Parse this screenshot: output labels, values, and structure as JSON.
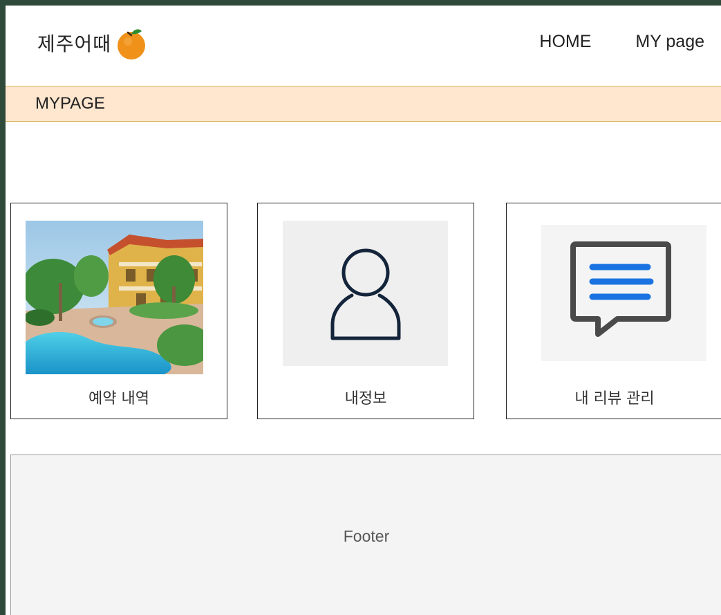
{
  "brand": {
    "name": "제주어때",
    "logo_icon": "orange-icon",
    "accent": "#f0921a"
  },
  "nav": {
    "home_label": "HOME",
    "mypage_label": "MY page"
  },
  "subbar": {
    "title": "MYPAGE",
    "background": "#ffe6cf"
  },
  "cards": [
    {
      "label": "예약 내역",
      "icon": "resort-photo"
    },
    {
      "label": "내정보",
      "icon": "user-icon"
    },
    {
      "label": "내 리뷰 관리",
      "icon": "chat-message-icon"
    }
  ],
  "footer": {
    "text": "Footer"
  }
}
